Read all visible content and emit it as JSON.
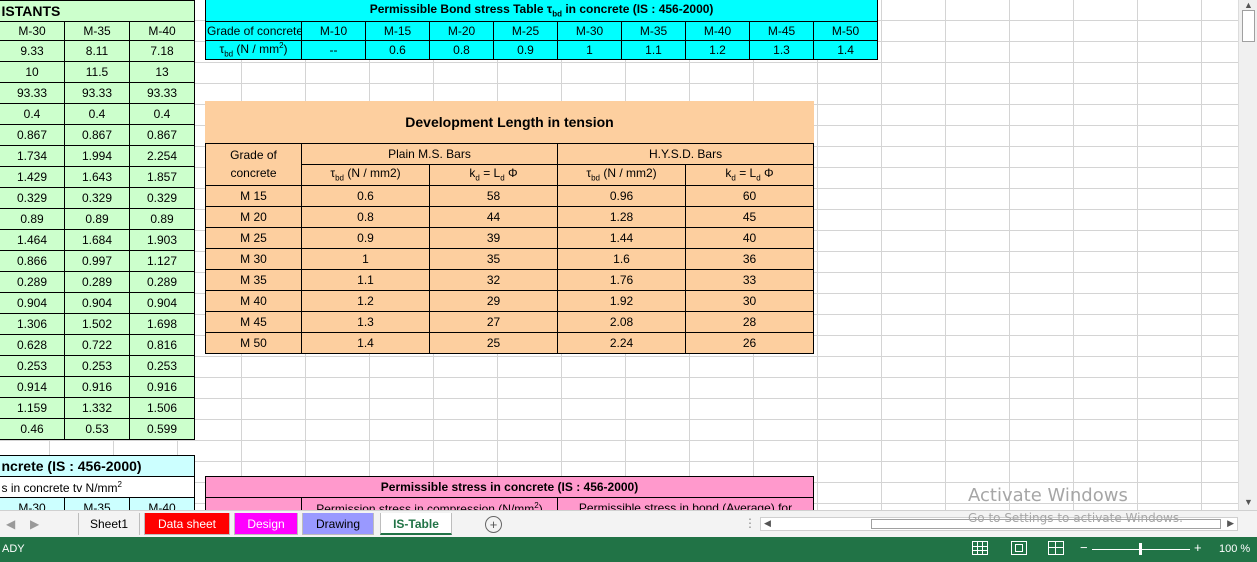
{
  "left_constants": {
    "title": "ISTANTS",
    "headers": [
      "M-30",
      "M-35",
      "M-40"
    ],
    "rows": [
      [
        "9.33",
        "8.11",
        "7.18"
      ],
      [
        "10",
        "11.5",
        "13"
      ],
      [
        "93.33",
        "93.33",
        "93.33"
      ],
      [
        "0.4",
        "0.4",
        "0.4"
      ],
      [
        "0.867",
        "0.867",
        "0.867"
      ],
      [
        "1.734",
        "1.994",
        "2.254"
      ],
      [
        "1.429",
        "1.643",
        "1.857"
      ],
      [
        "0.329",
        "0.329",
        "0.329"
      ],
      [
        "0.89",
        "0.89",
        "0.89"
      ],
      [
        "1.464",
        "1.684",
        "1.903"
      ],
      [
        "0.866",
        "0.997",
        "1.127"
      ],
      [
        "0.289",
        "0.289",
        "0.289"
      ],
      [
        "0.904",
        "0.904",
        "0.904"
      ],
      [
        "1.306",
        "1.502",
        "1.698"
      ],
      [
        "0.628",
        "0.722",
        "0.816"
      ],
      [
        "0.253",
        "0.253",
        "0.253"
      ],
      [
        "0.914",
        "0.916",
        "0.916"
      ],
      [
        "1.159",
        "1.332",
        "1.506"
      ],
      [
        "0.46",
        "0.53",
        "0.599"
      ]
    ],
    "bottom_title": "ncrete (IS : 456-2000)",
    "bottom_sub": "s  in concrete  tv  N/mm",
    "bottom_sub_sup": "2",
    "bottom_headers": [
      "M-30",
      "M-35",
      "M-40"
    ]
  },
  "bond_table": {
    "title_pre": "Permissible Bond  stress Table τ",
    "title_sub": "bd",
    "title_post": " in concrete (IS : 456-2000)",
    "row1_label": "Grade of concrete",
    "grades": [
      "M-10",
      "M-15",
      "M-20",
      "M-25",
      "M-30",
      "M-35",
      "M-40",
      "M-45",
      "M-50"
    ],
    "row2_label_pre": "τ",
    "row2_label_sub": "bd",
    "row2_label_post": "  (N / mm",
    "row2_label_sup": "2",
    "row2_label_end": ")",
    "values": [
      "--",
      "0.6",
      "0.8",
      "0.9",
      "1",
      "1.1",
      "1.2",
      "1.3",
      "1.4"
    ]
  },
  "dev_length": {
    "title": "Development   Length  in tension",
    "grade_header": "Grade of\nconcrete",
    "plain_header": "Plain M.S. Bars",
    "hysd_header": "H.Y.S.D. Bars",
    "tau_sub": "bd",
    "tau_label": "   (N / mm2)",
    "kd_label_k": "k",
    "kd_label_rest": " = L",
    "kd_sub_d": "d",
    "kd_phi": " Φ",
    "rows": [
      [
        "M 15",
        "0.6",
        "58",
        "0.96",
        "60"
      ],
      [
        "M 20",
        "0.8",
        "44",
        "1.28",
        "45"
      ],
      [
        "M 25",
        "0.9",
        "39",
        "1.44",
        "40"
      ],
      [
        "M 30",
        "1",
        "35",
        "1.6",
        "36"
      ],
      [
        "M 35",
        "1.1",
        "32",
        "1.76",
        "33"
      ],
      [
        "M 40",
        "1.2",
        "29",
        "1.92",
        "30"
      ],
      [
        "M 45",
        "1.3",
        "27",
        "2.08",
        "28"
      ],
      [
        "M 50",
        "1.4",
        "25",
        "2.24",
        "26"
      ]
    ]
  },
  "perm_stress": {
    "title": "Permissible  stress  in concrete (IS : 456-2000)",
    "col1_pre": "Permission stress in compression (N/mm",
    "col1_sup": "2",
    "col1_post": ")",
    "col2": "Permissible stress in bond (Average) for"
  },
  "tabs": [
    {
      "label": "Sheet1",
      "color": "#f3f3f3",
      "text": "#000000",
      "active": false
    },
    {
      "label": "Data sheet",
      "color": "#ff0000",
      "text": "#ffffff",
      "active": false
    },
    {
      "label": "Design",
      "color": "#ff00ff",
      "text": "#ffffff",
      "active": false
    },
    {
      "label": "Drawing",
      "color": "#9999ff",
      "text": "#000000",
      "active": false
    },
    {
      "label": "IS-Table",
      "color": "#ffffff",
      "text": "#000000",
      "active": true
    }
  ],
  "tab_nav": {
    "prev": "◀",
    "next": "▶"
  },
  "watermark": {
    "line1": "Activate Windows",
    "line2": "Go to Settings to activate Windows."
  },
  "status": {
    "left": "ADY",
    "zoom": "100 %"
  },
  "colors": {
    "status_bar": "#217346",
    "green": "#ccffcc",
    "cyan": "#00ffff",
    "peach": "#fdcf9f",
    "pink": "#ff99cc"
  }
}
